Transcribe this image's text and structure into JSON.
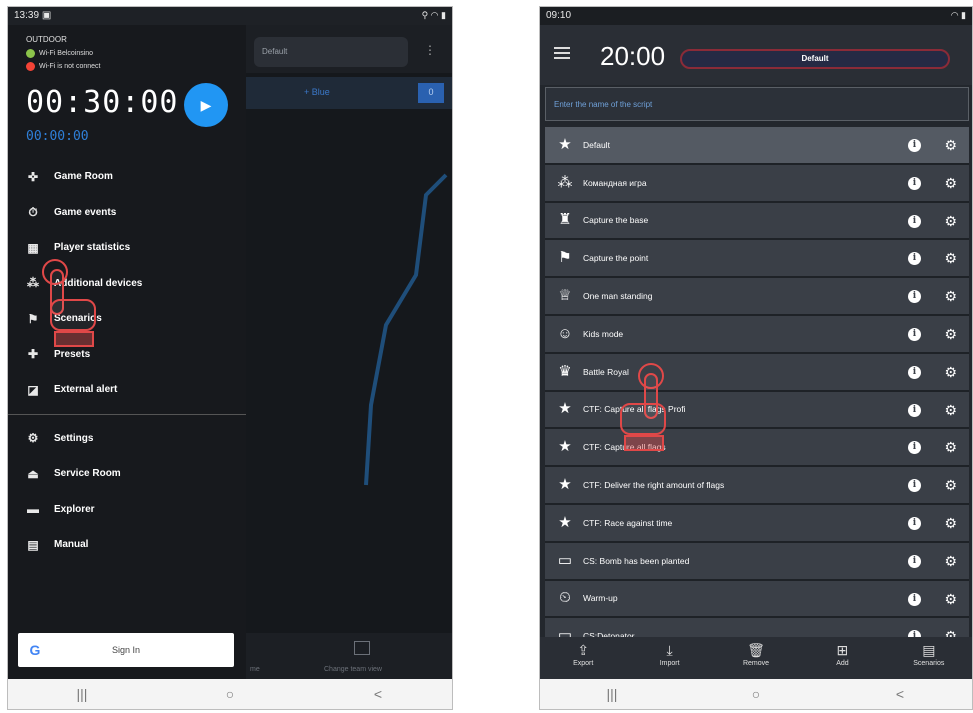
{
  "left_phone": {
    "status_time": "13:39",
    "drawer": {
      "mode": "OUTDOOR",
      "wifi_ok": "Wi-Fi Belcoinsino",
      "wifi_err": "Wi-Fi is not connect",
      "timer_main": "00:30:00",
      "timer_sub": "00:00:00",
      "menu": [
        {
          "label": "Game Room",
          "icon": "gamepad-icon",
          "glyph": "✜"
        },
        {
          "label": "Game events",
          "icon": "timer-icon",
          "glyph": "⏱"
        },
        {
          "label": "Player statistics",
          "icon": "stats-icon",
          "glyph": "▦"
        },
        {
          "label": "Additional devices",
          "icon": "devices-icon",
          "glyph": "⁂"
        },
        {
          "label": "Scenarios",
          "icon": "flag-icon",
          "glyph": "⚑"
        },
        {
          "label": "Presets",
          "icon": "puzzle-icon",
          "glyph": "✚"
        },
        {
          "label": "External alert",
          "icon": "alert-icon",
          "glyph": "◪"
        }
      ],
      "menu2": [
        {
          "label": "Settings",
          "icon": "gear-icon",
          "glyph": "⚙"
        },
        {
          "label": "Service Room",
          "icon": "eject-icon",
          "glyph": "⏏"
        },
        {
          "label": "Explorer",
          "icon": "folder-icon",
          "glyph": "▬"
        },
        {
          "label": "Manual",
          "icon": "book-icon",
          "glyph": "▤"
        }
      ],
      "signin": "Sign In",
      "google_glyph": "G"
    },
    "background": {
      "pill": "Default",
      "bar_text": "+ Blue",
      "bar_btn": "0",
      "bottom_left": "me",
      "bottom_right": "Change team view"
    }
  },
  "right_phone": {
    "status_time": "09:10",
    "timer": "20:00",
    "pill": "Default",
    "search_placeholder": "Enter the name of the script",
    "scripts": [
      {
        "label": "Default",
        "icon": "star-icon",
        "glyph": "★",
        "selected": true
      },
      {
        "label": "Командная игра",
        "icon": "team-icon",
        "glyph": "⁂"
      },
      {
        "label": "Capture the base",
        "icon": "castle-icon",
        "glyph": "♜"
      },
      {
        "label": "Capture the point",
        "icon": "flag-icon",
        "glyph": "⚑"
      },
      {
        "label": "One man standing",
        "icon": "trophy-icon",
        "glyph": "♕"
      },
      {
        "label": "Kids mode",
        "icon": "smile-icon",
        "glyph": "☺"
      },
      {
        "label": "Battle Royal",
        "icon": "crown-icon",
        "glyph": "♛"
      },
      {
        "label": "CTF: Capture all flags Profi",
        "icon": "star-icon",
        "glyph": "★"
      },
      {
        "label": "CTF: Capture all flags",
        "icon": "star-icon",
        "glyph": "★"
      },
      {
        "label": "CTF: Deliver the right amount of flags",
        "icon": "star-icon",
        "glyph": "★"
      },
      {
        "label": "CTF: Race against time",
        "icon": "star-icon",
        "glyph": "★"
      },
      {
        "label": "CS: Bomb has been planted",
        "icon": "bomb-icon",
        "glyph": "▭"
      },
      {
        "label": "Warm-up",
        "icon": "stopwatch-icon",
        "glyph": "⏲"
      },
      {
        "label": "CS:Detonator",
        "icon": "detonator-icon",
        "glyph": "▭"
      }
    ],
    "toolbar": [
      {
        "label": "Export",
        "icon": "export-icon",
        "glyph": "⇪"
      },
      {
        "label": "Import",
        "icon": "import-icon",
        "glyph": "⤓"
      },
      {
        "label": "Remove",
        "icon": "trash-icon",
        "glyph": "🗑"
      },
      {
        "label": "Add",
        "icon": "add-icon",
        "glyph": "⊞"
      },
      {
        "label": "Scenarios",
        "icon": "scenarios-icon",
        "glyph": "▤"
      }
    ]
  },
  "nav": {
    "recents": "|||",
    "home": "○",
    "back": "<"
  },
  "colors": {
    "accent_blue": "#2196f3",
    "wifi_green": "#8bc34a",
    "wifi_red": "#f44336",
    "gesture_red": "#e04848"
  }
}
